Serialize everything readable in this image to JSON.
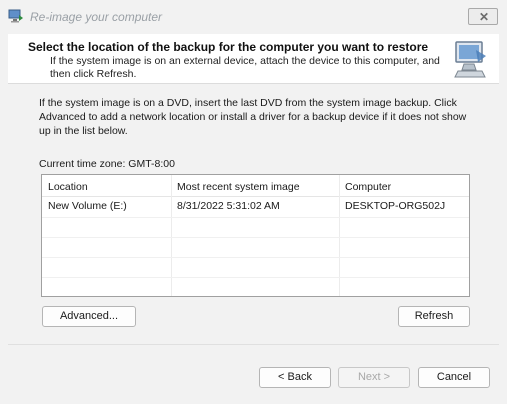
{
  "window": {
    "title": "Re-image your computer",
    "close_glyph": "✕"
  },
  "header": {
    "title": "Select the location of the backup for the computer you want to restore",
    "subtitle": "If the system image is on an external device, attach the device to this computer, and then click Refresh.",
    "icon": "computer-restore-icon"
  },
  "info": "If the system image is on a DVD, insert the last DVD from the system image backup. Click Advanced to add a network location or install a driver for a backup device if it does not show up in the list below.",
  "timezone": "Current time zone: GMT-8:00",
  "table": {
    "columns": [
      "Location",
      "Most recent system image",
      "Computer"
    ],
    "rows": [
      [
        "New Volume (E:)",
        "8/31/2022 5:31:02 AM",
        "DESKTOP-ORG502J"
      ]
    ]
  },
  "buttons": {
    "advanced": "Advanced...",
    "refresh": "Refresh",
    "back": "< Back",
    "next": "Next >",
    "cancel": "Cancel"
  },
  "colors": {
    "accent": "#1a5fb4",
    "background": "#f2f2f2"
  }
}
